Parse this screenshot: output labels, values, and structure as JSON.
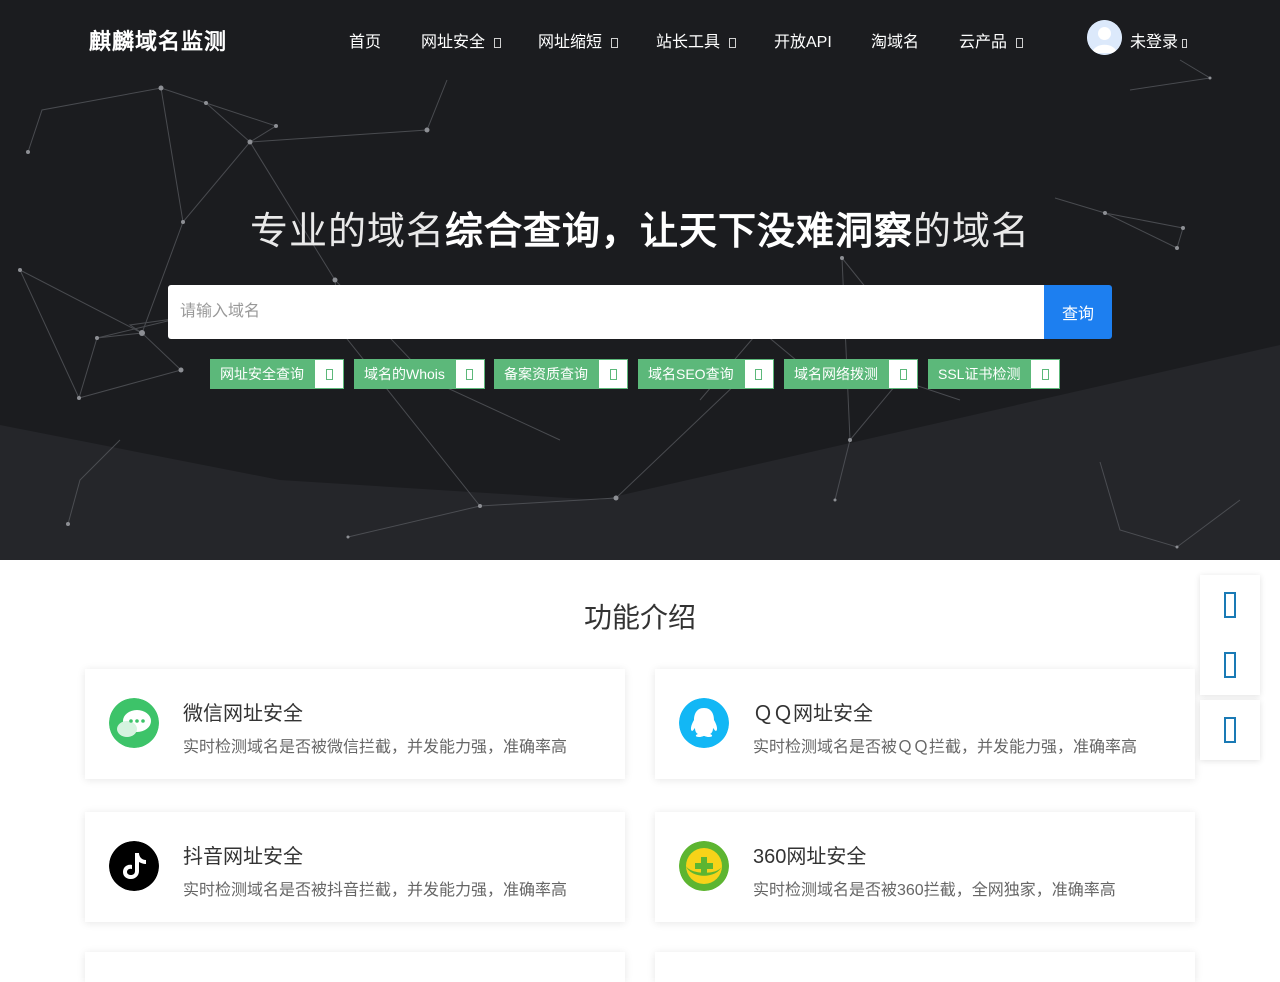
{
  "header": {
    "logo": "麒麟域名监测",
    "nav": [
      {
        "label": "首页",
        "dropdown": false
      },
      {
        "label": "网址安全",
        "dropdown": true
      },
      {
        "label": "网址缩短",
        "dropdown": true
      },
      {
        "label": "站长工具",
        "dropdown": true
      },
      {
        "label": "开放API",
        "dropdown": false
      },
      {
        "label": "淘域名",
        "dropdown": false
      },
      {
        "label": "云产品",
        "dropdown": true
      }
    ],
    "user_label": "未登录"
  },
  "hero": {
    "slogan_light_1": "专业的域名",
    "slogan_bold": "综合查询，让天下没难洞察",
    "slogan_light_2": "的域名",
    "search_placeholder": "请输入域名",
    "search_button": "查询",
    "quick_tags": [
      "网址安全查询",
      "域名的Whois",
      "备案资质查询",
      "域名SEO查询",
      "域名网络拨测",
      "SSL证书检测"
    ]
  },
  "features": {
    "title": "功能介绍",
    "cards": [
      {
        "title": "微信网址安全",
        "desc": "实时检测域名是否被微信拦截，并发能力强，准确率高",
        "icon": "wechat-icon"
      },
      {
        "title": "ＱＱ网址安全",
        "desc": "实时检测域名是否被ＱＱ拦截，并发能力强，准确率高",
        "icon": "qq-icon"
      },
      {
        "title": "抖音网址安全",
        "desc": "实时检测域名是否被抖音拦截，并发能力强，准确率高",
        "icon": "douyin-icon"
      },
      {
        "title": "360网址安全",
        "desc": "实时检测域名是否被360拦截，全网独家，准确率高",
        "icon": "360-icon"
      }
    ]
  },
  "colors": {
    "hero_bg": "#1b1c1f",
    "accent": "#1d7ff0",
    "tag_green": "#5cb87a",
    "wechat": "#3dc369",
    "qq": "#12b7f5",
    "float_icon": "#1a7ab5"
  },
  "float_icons": [
    "side-icon-1",
    "side-icon-2",
    "side-icon-3"
  ]
}
